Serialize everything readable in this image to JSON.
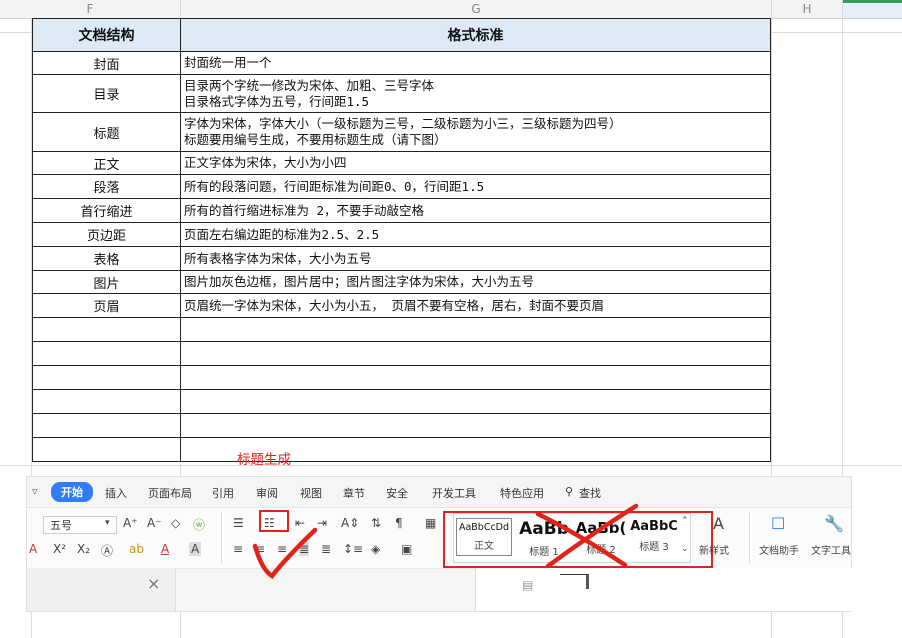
{
  "column_headers": [
    "F",
    "G",
    "H"
  ],
  "table": {
    "headers": [
      "文档结构",
      "格式标准"
    ],
    "rows": [
      {
        "name": "封面",
        "lines": [
          "封面统一用一个"
        ]
      },
      {
        "name": "目录",
        "lines": [
          "目录两个字统一修改为宋体、加粗、三号字体",
          "目录格式字体为五号，行间距1.5"
        ]
      },
      {
        "name": "标题",
        "lines": [
          "字体为宋体，字体大小（一级标题为三号，二级标题为小三，三级标题为四号）",
          "标题要用编号生成，不要用标题生成（请下图）"
        ]
      },
      {
        "name": "正文",
        "lines": [
          "正文字体为宋体，大小为小四"
        ]
      },
      {
        "name": "段落",
        "lines": [
          "所有的段落问题，行间距标准为间距0、0，行间距1.5"
        ]
      },
      {
        "name": "首行缩进",
        "lines": [
          "所有的首行缩进标准为 2，不要手动敲空格"
        ]
      },
      {
        "name": "页边距",
        "lines": [
          "页面左右编边距的标准为2.5、2.5"
        ]
      },
      {
        "name": "表格",
        "lines": [
          "所有表格字体为宋体，大小为五号"
        ]
      },
      {
        "name": "图片",
        "lines": [
          "图片加灰色边框，图片居中；图片图注字体为宋体，大小为五号"
        ]
      },
      {
        "name": "页眉",
        "lines": [
          "页眉统一字体为宋体，大小为小五， 页眉不要有空格，居右，封面不要页眉"
        ]
      }
    ]
  },
  "annotation_label": "标题生成",
  "ribbon": {
    "tabs": [
      "开始",
      "插入",
      "页面布局",
      "引用",
      "审阅",
      "视图",
      "章节",
      "安全",
      "开发工具",
      "特色应用",
      "查找"
    ],
    "font_size": "五号",
    "styles": [
      {
        "sample": "AaBbCcDd",
        "name": "正文"
      },
      {
        "sample": "AaBb",
        "name": "标题 1"
      },
      {
        "sample": "AaBb(",
        "name": "标题 2"
      },
      {
        "sample": "AaBbC",
        "name": "标题 3"
      }
    ],
    "new_style": "新样式",
    "doc_helper": "文档助手",
    "text_tools": "文字工具"
  },
  "colors": {
    "accent": "#2f7cf6",
    "annotation_red": "#e2231a",
    "header_fill": "#dde9f5",
    "selected_col": "#3f9a5a"
  }
}
